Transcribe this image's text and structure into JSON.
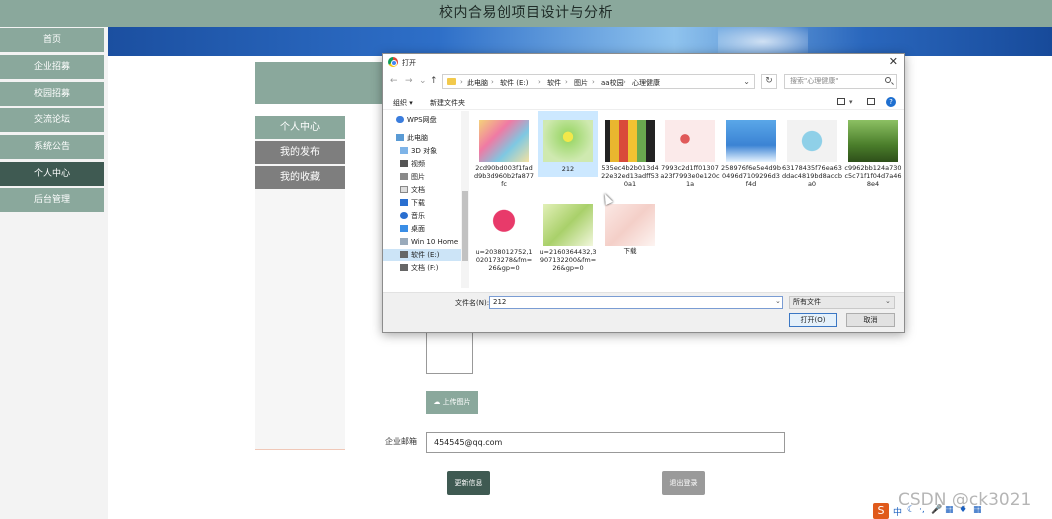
{
  "header": {
    "title": "校内合易创项目设计与分析"
  },
  "nav": {
    "items": [
      {
        "label": "首页",
        "active": false
      },
      {
        "label": "企业招募",
        "active": false
      },
      {
        "label": "校园招募",
        "active": false
      },
      {
        "label": "交流论坛",
        "active": false
      },
      {
        "label": "系统公告",
        "active": false
      },
      {
        "label": "个人中心",
        "active": true
      },
      {
        "label": "后台管理",
        "active": false
      }
    ]
  },
  "sidebar": {
    "links": [
      {
        "label": "个人中心",
        "active": true
      },
      {
        "label": "我的发布",
        "active": false
      },
      {
        "label": "我的收藏",
        "active": false
      }
    ]
  },
  "form": {
    "upload_label": "上传图片",
    "email_label": "企业邮箱",
    "email_value": "454545@qq.com",
    "update_label": "更新信息",
    "logout_label": "退出登录"
  },
  "dialog": {
    "title": "打开",
    "breadcrumb": [
      "此电脑",
      "软件 (E:)",
      "软件",
      "图片",
      "aa校园",
      "心理健康"
    ],
    "search_placeholder": "搜索\"心理健康\"",
    "organize_label": "组织 ▾",
    "new_folder_label": "新建文件夹",
    "tree": [
      {
        "label": "WPS网盘",
        "selected": false
      },
      {
        "label": "此电脑",
        "selected": false
      },
      {
        "label": "3D 对象",
        "selected": false
      },
      {
        "label": "视频",
        "selected": false
      },
      {
        "label": "图片",
        "selected": false
      },
      {
        "label": "文档",
        "selected": false
      },
      {
        "label": "下载",
        "selected": false
      },
      {
        "label": "音乐",
        "selected": false
      },
      {
        "label": "桌面",
        "selected": false
      },
      {
        "label": "Win 10 Home (",
        "selected": false
      },
      {
        "label": "软件 (E:)",
        "selected": true
      },
      {
        "label": "文档 (F:)",
        "selected": false
      }
    ],
    "files": [
      {
        "name": "2cd90bd003f1fadd9b3d960b2fa877fc",
        "selected": false
      },
      {
        "name": "212",
        "selected": true
      },
      {
        "name": "535ec4b2b013d422e32ed13adff530a1",
        "selected": false
      },
      {
        "name": "7993c2d1ff01307a23f7993e0e120c1a",
        "selected": false
      },
      {
        "name": "258976f6e5e4d9b0496d7109296d3f4d",
        "selected": false
      },
      {
        "name": "63178435f76ea63ddac4819bd8accba0",
        "selected": false
      },
      {
        "name": "c9962bb124a730c5c71f1f04d7a468e4",
        "selected": false
      },
      {
        "name": "u=2038012752,1020173278&fm=26&gp=0",
        "selected": false
      },
      {
        "name": "u=2160364432,3907132200&fm=26&gp=0",
        "selected": false
      },
      {
        "name": "下载",
        "selected": false
      }
    ],
    "filename_label": "文件名(N):",
    "filename_value": "212",
    "filetype_value": "所有文件",
    "open_label": "打开(O)",
    "cancel_label": "取消"
  },
  "watermark": "CSDN @ck3021",
  "tray": {
    "logo": "S",
    "lang": "中"
  }
}
